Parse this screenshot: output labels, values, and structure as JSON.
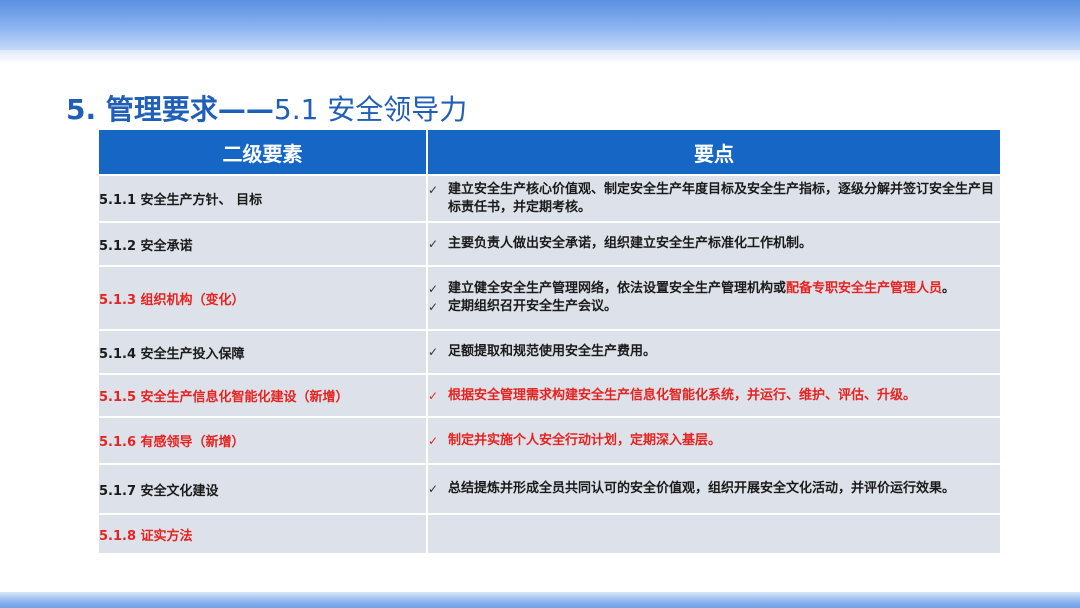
{
  "title": {
    "number": "5. 管理要求——",
    "sub": "5.1 安全领导力"
  },
  "table": {
    "headers": [
      "二级要素",
      "要点"
    ],
    "rows": [
      {
        "element": "5.1.1 安全生产方针、 目标",
        "points": [
          "建立安全生产核心价值观、制定安全生产年度目标及安全生产指标，逐级分解并签订安全生产目标责任书，并定期考核。"
        ]
      },
      {
        "element": "5.1.2 安全承诺",
        "points": [
          "主要负责人做出安全承诺，组织建立安全生产标准化工作机制。"
        ]
      },
      {
        "element": "5.1.3 组织机构（变化）",
        "points_a": "建立健全安全生产管理网络，依法设置安全生产管理机构或",
        "points_a_hl": "配备专职安全生产管理人员",
        "points_a_end": "。",
        "points_b": "定期组织召开安全生产会议。"
      },
      {
        "element": "5.1.4 安全生产投入保障",
        "points": [
          "足额提取和规范使用安全生产费用。"
        ]
      },
      {
        "element": "5.1.5 安全生产信息化智能化建设（新增）",
        "points": [
          "根据安全管理需求构建安全生产信息化智能化系统，并运行、维护、评估、升级。"
        ]
      },
      {
        "element": "5.1.6 有感领导（新增）",
        "points": [
          "制定并实施个人安全行动计划，定期深入基层。"
        ]
      },
      {
        "element": "5.1.7 安全文化建设",
        "points": [
          "总结提炼并形成全员共同认可的安全价值观，组织开展安全文化活动，并评价运行效果。"
        ]
      },
      {
        "element": "5.1.8 证实方法",
        "points": []
      }
    ]
  },
  "check_mark": "✓",
  "colors": {
    "header": "#1666c6",
    "title": "#1f5fb8",
    "highlight": "#e52320",
    "cell": "#dde2ea"
  }
}
